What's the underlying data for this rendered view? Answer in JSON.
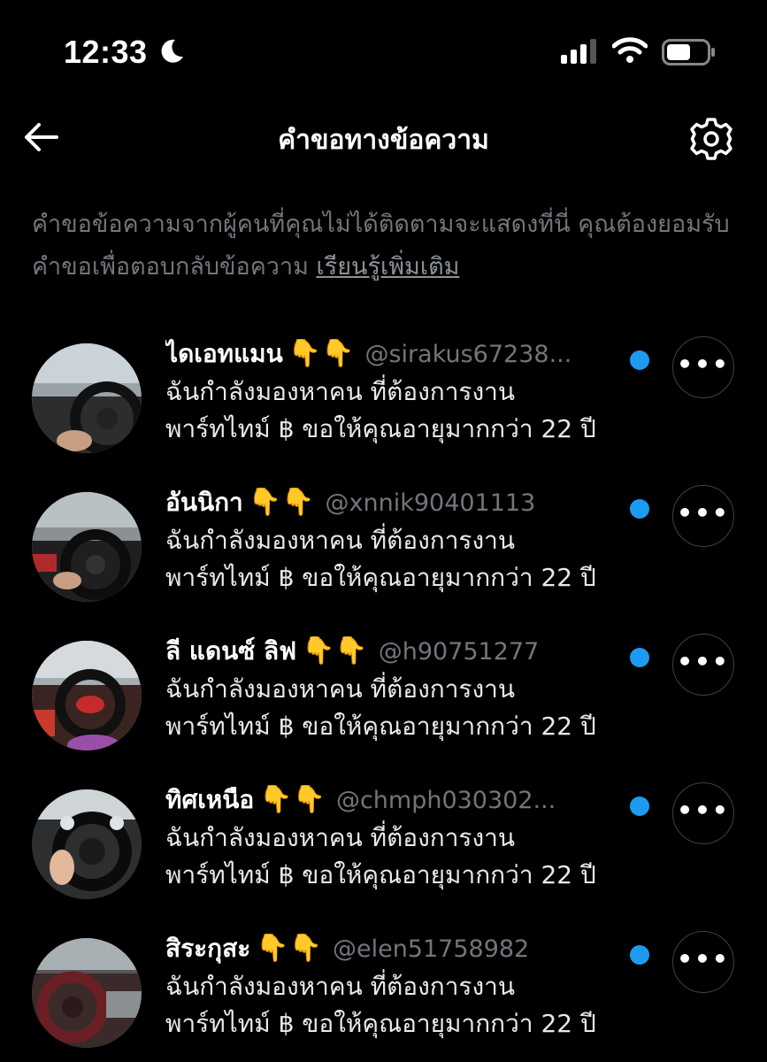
{
  "status_bar": {
    "time": "12:33",
    "moon_icon": "moon-icon",
    "signal_icon": "cellular-signal-icon",
    "wifi_icon": "wifi-icon",
    "battery_icon": "battery-icon"
  },
  "header": {
    "title": "คำขอทางข้อความ",
    "back_icon": "back-arrow-icon",
    "settings_icon": "gear-icon"
  },
  "info": {
    "text": "คำขอข้อความจากผู้คนที่คุณไม่ได้ติดตามจะแสดงที่นี่ คุณต้องยอมรับคำขอเพื่อตอบกลับข้อความ ",
    "link": "เรียนรู้เพิ่มเติม"
  },
  "requests": [
    {
      "name": "ไดเอทแมน",
      "emoji": "👇👇",
      "handle": "@sirakus67238...",
      "line1": "ฉันกำลังมองหาคน ที่ต้องการงาน",
      "line2": "พาร์ทไทม์ ฿ ขอให้คุณอายุมากกว่า 22 ปี"
    },
    {
      "name": "อันนิกา",
      "emoji": "👇👇",
      "handle": "@xnnik90401113",
      "line1": "ฉันกำลังมองหาคน ที่ต้องการงาน",
      "line2": "พาร์ทไทม์ ฿ ขอให้คุณอายุมากกว่า 22 ปี"
    },
    {
      "name": "ลี แดนซ์ ลิฟ",
      "emoji": "👇👇",
      "handle": "@h90751277",
      "line1": "ฉันกำลังมองหาคน ที่ต้องการงาน",
      "line2": "พาร์ทไทม์ ฿ ขอให้คุณอายุมากกว่า 22 ปี"
    },
    {
      "name": "ทิศเหนือ",
      "emoji": "👇👇",
      "handle": "@chmph030302...",
      "line1": "ฉันกำลังมองหาคน ที่ต้องการงาน",
      "line2": "พาร์ทไทม์ ฿ ขอให้คุณอายุมากกว่า 22 ปี"
    },
    {
      "name": "สิระกุสะ",
      "emoji": "👇👇",
      "handle": "@elen51758982",
      "line1": "ฉันกำลังมองหาคน ที่ต้องการงาน",
      "line2": "พาร์ทไทม์ ฿ ขอให้คุณอายุมากกว่า 22 ปี"
    }
  ],
  "more_label": "•••",
  "colors": {
    "background": "#000000",
    "unread_dot": "#1d9bf0",
    "secondary_text": "#71767b"
  }
}
